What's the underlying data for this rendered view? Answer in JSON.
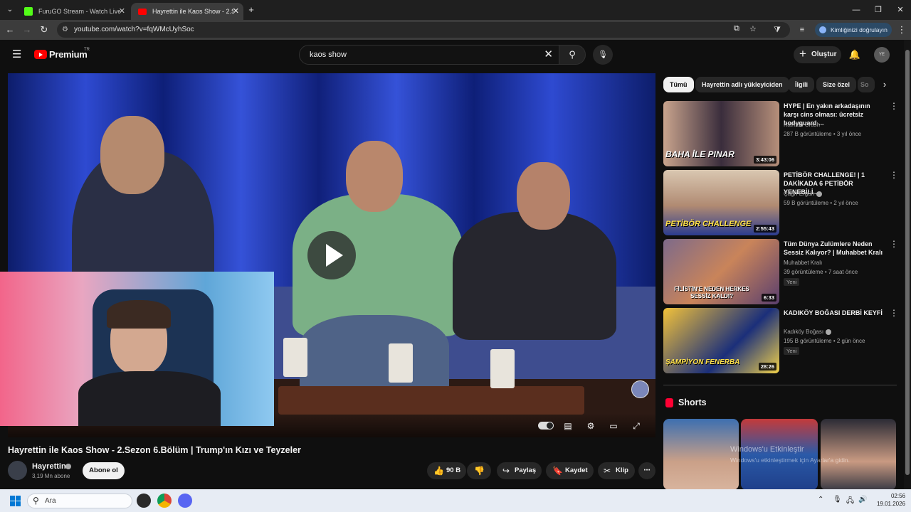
{
  "browser": {
    "tabs": [
      {
        "title": "FuruGO Stream - Watch Live on",
        "active": false,
        "favicon_color": "#53fc18"
      },
      {
        "title": "Hayrettin ile Kaos Show - 2.Sez",
        "active": true,
        "favicon_color": "#ff0000"
      }
    ],
    "new_tab_icon": "plus-icon",
    "url": "youtube.com/watch?v=fqWMcUyhSoc",
    "verify_label": "Kimliğinizi doğrulayın"
  },
  "youtube": {
    "logo_text": "Premium",
    "logo_region": "TR",
    "search_query": "kaos show",
    "create_label": "Oluştur",
    "avatar_initials": "YE"
  },
  "video": {
    "title": "Hayrettin ile Kaos Show - 2.Sezon 6.Bölüm | Trump'ın Kızı ve Teyzeler",
    "channel_name": "Hayrettin",
    "subscribers": "3,19 Mn abone",
    "subscribe_label": "Abone ol",
    "like_count": "90 B",
    "share_label": "Paylaş",
    "save_label": "Kaydet",
    "clip_label": "Klip"
  },
  "sidebar": {
    "chips": [
      "Tümü",
      "Hayrettin adlı yükleyiciden",
      "İlgili",
      "Size özel",
      "So"
    ],
    "recommendations": [
      {
        "title": "HYPE | En yakın arkadaşının karşı cins olması: ücretsiz bodyguard ...",
        "channel": "Katman Crash",
        "verified": false,
        "meta": "287 B görüntüleme • 3 yıl önce",
        "duration": "3:43:06",
        "overlay": "BAHA İLE PINAR",
        "badge": ""
      },
      {
        "title": "PETİBÖR CHALLENGE! | 1 DAKİKADA 6 PETİBÖR YENEBİLİ...",
        "channel": "Çağrı Ergün",
        "verified": true,
        "meta": "59 B görüntüleme • 2 yıl önce",
        "duration": "2:55:43",
        "overlay": "PETİBÖR CHALLENGE",
        "badge": ""
      },
      {
        "title": "Tüm Dünya Zulümlere Neden Sessiz Kalıyor? | Muhabbet Kralı",
        "channel": "Muhabbet Kralı",
        "verified": false,
        "meta": "39 görüntüleme • 7 saat önce",
        "duration": "6:33",
        "overlay": "FİLİSTİN'E NEDEN HERKES SESSİZ KALDI?",
        "badge": "Yeni"
      },
      {
        "title": "KADIKÖY BOĞASI DERBİ KEYFİ",
        "channel": "Kadıköy Boğası",
        "verified": true,
        "meta": "195 B görüntüleme • 2 gün önce",
        "duration": "28:26",
        "overlay": "ŞAMPİYON FENERBA",
        "badge": "Yeni"
      }
    ],
    "shorts_title": "Shorts",
    "watermark_line1": "Windows'u Etkinleştir",
    "watermark_line2": "Windows'u etkinleştirmek için Ayarlar'a gidin."
  },
  "taskbar": {
    "search_placeholder": "Ara",
    "time": "02:56",
    "date": "19.01.2026"
  }
}
